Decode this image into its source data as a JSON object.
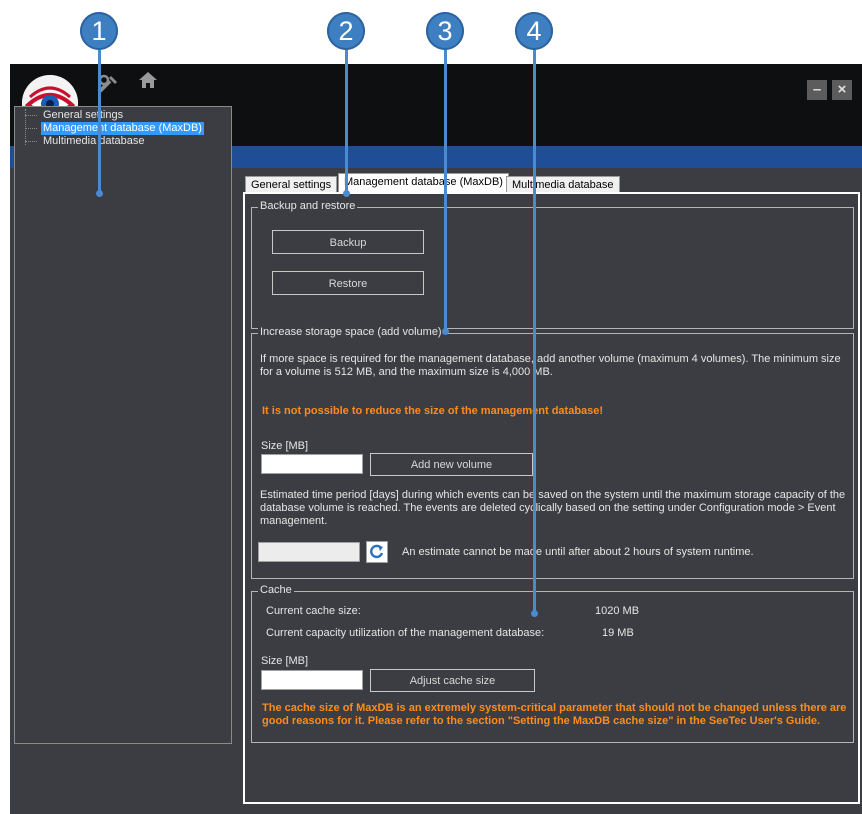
{
  "callouts": [
    "1",
    "2",
    "3",
    "4"
  ],
  "window": {
    "toolbar_icons": [
      "tools-icon",
      "home-icon"
    ],
    "minimize": "–",
    "close": "×"
  },
  "tree": {
    "items": [
      {
        "label": "General settings"
      },
      {
        "label": "Management database (MaxDB)",
        "selected": true
      },
      {
        "label": "Multimedia database"
      }
    ]
  },
  "tabs": [
    {
      "label": "General settings"
    },
    {
      "label": "Management database (MaxDB)",
      "active": true
    },
    {
      "label": "Multimedia database"
    }
  ],
  "backup": {
    "legend": "Backup and restore",
    "backup_label": "Backup",
    "restore_label": "Restore"
  },
  "storage": {
    "legend": "Increase storage space (add volume)",
    "description": "If more space is required for the management database, add another volume (maximum 4 volumes). The minimum size for a volume is 512 MB, and the maximum size is 4,000 MB.",
    "warning": "It is not possible to reduce the size of the management database!",
    "size_label": "Size [MB]",
    "size_value": "",
    "add_label": "Add new volume",
    "estimate_description": "Estimated time period [days] during which events can be saved on the system until the maximum storage capacity of the database volume is reached. The events are deleted cyclically based on the setting under Configuration mode > Event management.",
    "estimate_value": "",
    "estimate_note": "An estimate cannot be made until after about 2 hours of system runtime."
  },
  "cache": {
    "legend": "Cache",
    "current_label": "Current cache size:",
    "current_value": "1020 MB",
    "utilization_label": "Current capacity utilization of the management database:",
    "utilization_value": "19 MB",
    "size_label": "Size [MB]",
    "size_value": "",
    "adjust_label": "Adjust cache size",
    "warning": "The cache size of MaxDB is an extremely system-critical parameter that should not be changed unless there are good reasons for it. Please refer to the section \"Setting the MaxDB cache size\" in the SeeTec User's Guide."
  },
  "colors": {
    "accent": "#1f4e96",
    "warning": "#ff8c1a",
    "selection": "#3399ff",
    "callout": "#3e7fc2"
  }
}
